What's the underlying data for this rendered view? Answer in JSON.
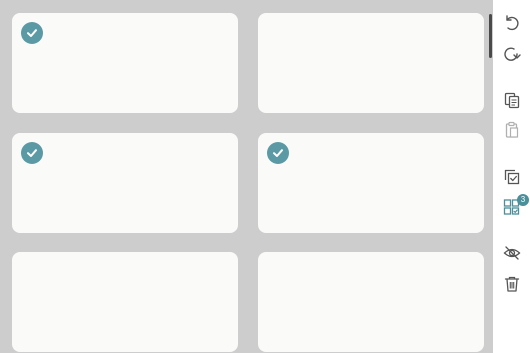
{
  "colors": {
    "background": "#cdcdcd",
    "card": "#fafaf9",
    "check": "#5b9aa5",
    "icon": "#555555",
    "icon_disabled": "#b0b0b0",
    "accent": "#4a8f9a"
  },
  "cards": [
    {
      "selected": true
    },
    {
      "selected": false
    },
    {
      "selected": true
    },
    {
      "selected": true
    },
    {
      "selected": false
    },
    {
      "selected": false
    }
  ],
  "toolbar": {
    "undo_icon": "undo-icon",
    "redo_icon": "redo-icon",
    "copy_icon": "copy-icon",
    "paste_icon": "paste-icon",
    "select_icon": "select-box-icon",
    "selected_grid_icon": "selected-grid-icon",
    "selected_count": "3",
    "hide_icon": "eye-slash-icon",
    "delete_icon": "trash-icon"
  }
}
